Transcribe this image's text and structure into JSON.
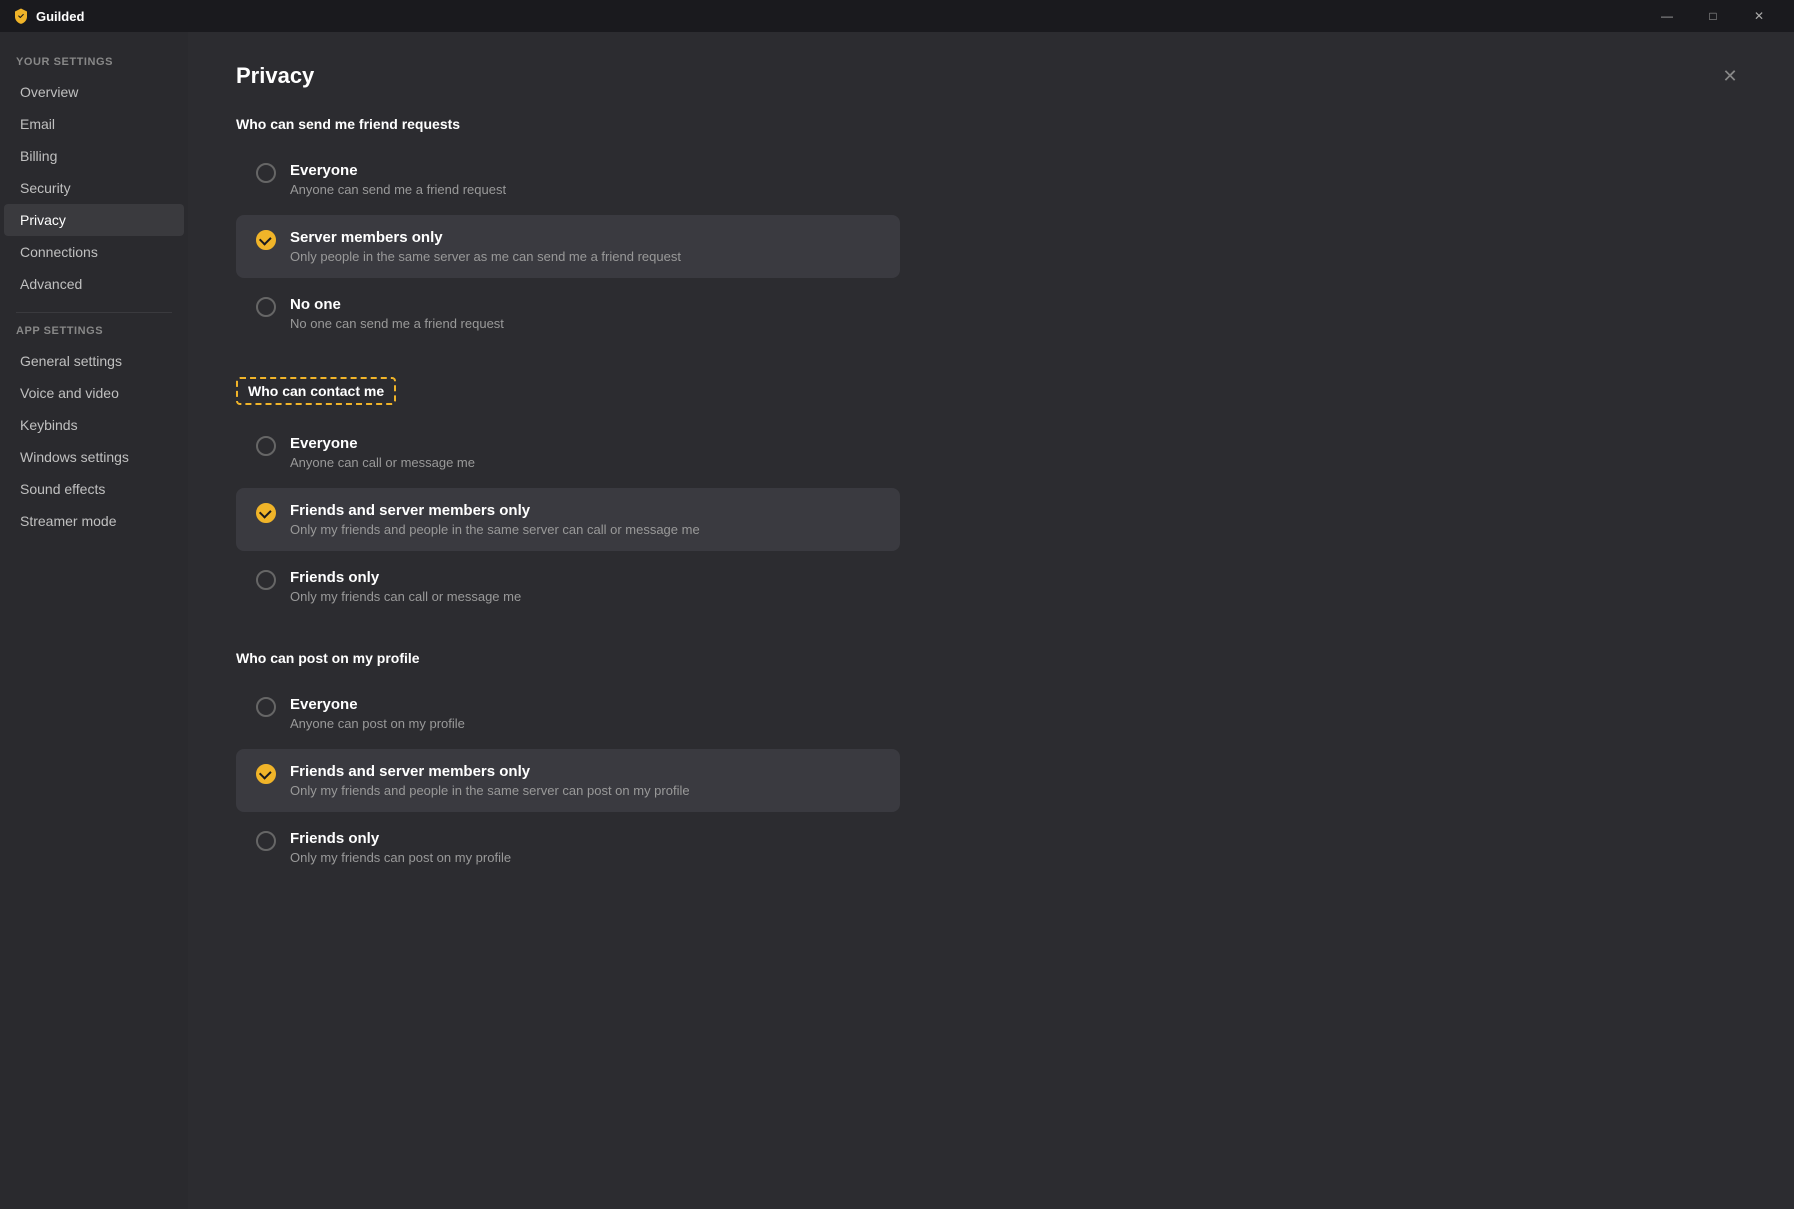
{
  "titleBar": {
    "logo": "Guilded",
    "controls": {
      "minimize": "—",
      "maximize": "□",
      "close": "✕"
    }
  },
  "sidebar": {
    "yourSettings": {
      "label": "Your settings",
      "items": [
        {
          "id": "overview",
          "label": "Overview",
          "active": false
        },
        {
          "id": "email",
          "label": "Email",
          "active": false
        },
        {
          "id": "billing",
          "label": "Billing",
          "active": false
        },
        {
          "id": "security",
          "label": "Security",
          "active": false
        },
        {
          "id": "privacy",
          "label": "Privacy",
          "active": true
        },
        {
          "id": "connections",
          "label": "Connections",
          "active": false
        },
        {
          "id": "advanced",
          "label": "Advanced",
          "active": false
        }
      ]
    },
    "appSettings": {
      "label": "App settings",
      "items": [
        {
          "id": "general-settings",
          "label": "General settings",
          "active": false
        },
        {
          "id": "voice-and-video",
          "label": "Voice and video",
          "active": false
        },
        {
          "id": "keybinds",
          "label": "Keybinds",
          "active": false
        },
        {
          "id": "windows-settings",
          "label": "Windows settings",
          "active": false
        },
        {
          "id": "sound-effects",
          "label": "Sound effects",
          "active": false
        },
        {
          "id": "streamer-mode",
          "label": "Streamer mode",
          "active": false
        }
      ]
    }
  },
  "page": {
    "title": "Privacy",
    "sections": {
      "friendRequests": {
        "title": "Who can send me friend requests",
        "options": [
          {
            "id": "fr-everyone",
            "label": "Everyone",
            "desc": "Anyone can send me a friend request",
            "selected": false
          },
          {
            "id": "fr-server-members",
            "label": "Server members only",
            "desc": "Only people in the same server as me can send me a friend request",
            "selected": true
          },
          {
            "id": "fr-no-one",
            "label": "No one",
            "desc": "No one can send me a friend request",
            "selected": false
          }
        ]
      },
      "contactMe": {
        "title": "Who can contact me",
        "highlighted": true,
        "options": [
          {
            "id": "cm-everyone",
            "label": "Everyone",
            "desc": "Anyone can call or message me",
            "selected": false
          },
          {
            "id": "cm-friends-server",
            "label": "Friends and server members only",
            "desc": "Only my friends and people in the same server can call or message me",
            "selected": true
          },
          {
            "id": "cm-friends-only",
            "label": "Friends only",
            "desc": "Only my friends can call or message me",
            "selected": false
          }
        ]
      },
      "postOnProfile": {
        "title": "Who can post on my profile",
        "options": [
          {
            "id": "pp-everyone",
            "label": "Everyone",
            "desc": "Anyone can post on my profile",
            "selected": false
          },
          {
            "id": "pp-friends-server",
            "label": "Friends and server members only",
            "desc": "Only my friends and people in the same server can post on my profile",
            "selected": true
          },
          {
            "id": "pp-friends-only",
            "label": "Friends only",
            "desc": "Only my friends can post on my profile",
            "selected": false
          }
        ]
      }
    }
  }
}
